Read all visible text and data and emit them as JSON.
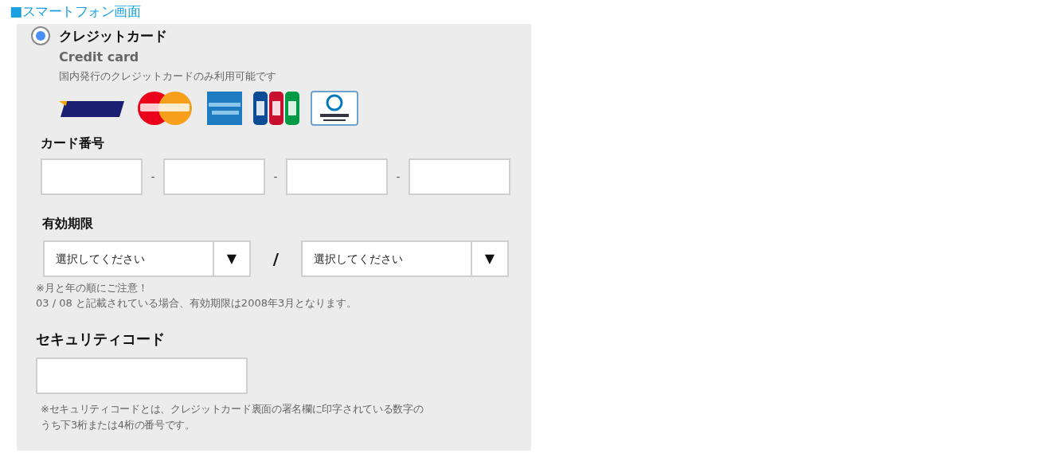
{
  "heading": "■スマートフォン画面",
  "payment_option": {
    "label": "クレジットカード",
    "sublabel": "Credit card",
    "note": "国内発行のクレジットカードのみ利用可能です",
    "selected": true
  },
  "card_number": {
    "label": "カード番号",
    "separators": [
      "-",
      "-",
      "-"
    ]
  },
  "expiry": {
    "label": "有効期限",
    "selects": [
      {
        "value": "選択してください",
        "arrow": "▼"
      },
      {
        "value": "選択してください",
        "arrow": "▼"
      }
    ],
    "separator": "/",
    "note_lines": [
      "※月と年の順にご注意！",
      "03 / 08 と記載されている場合、有効期限は2008年3月となります。"
    ]
  },
  "security_code": {
    "label": "セキュリティコード",
    "note_lines": [
      "※セキュリティコードとは、クレジットカード裏面の署名欄に印字されている数字の",
      "うち下3桁または4桁の番号です。"
    ]
  }
}
